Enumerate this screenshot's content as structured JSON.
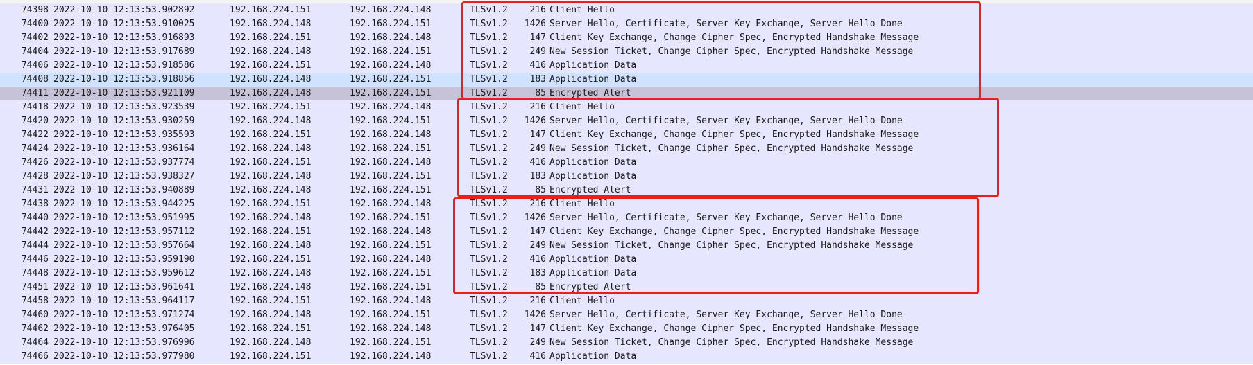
{
  "packets": [
    {
      "no": "74398",
      "time": "2022-10-10 12:13:53.902892",
      "src": "192.168.224.151",
      "dst": "192.168.224.148",
      "proto": "TLSv1.2",
      "len": "216",
      "info": "Client Hello"
    },
    {
      "no": "74400",
      "time": "2022-10-10 12:13:53.910025",
      "src": "192.168.224.148",
      "dst": "192.168.224.151",
      "proto": "TLSv1.2",
      "len": "1426",
      "info": "Server Hello, Certificate, Server Key Exchange, Server Hello Done"
    },
    {
      "no": "74402",
      "time": "2022-10-10 12:13:53.916893",
      "src": "192.168.224.151",
      "dst": "192.168.224.148",
      "proto": "TLSv1.2",
      "len": "147",
      "info": "Client Key Exchange, Change Cipher Spec, Encrypted Handshake Message"
    },
    {
      "no": "74404",
      "time": "2022-10-10 12:13:53.917689",
      "src": "192.168.224.148",
      "dst": "192.168.224.151",
      "proto": "TLSv1.2",
      "len": "249",
      "info": "New Session Ticket, Change Cipher Spec, Encrypted Handshake Message"
    },
    {
      "no": "74406",
      "time": "2022-10-10 12:13:53.918586",
      "src": "192.168.224.151",
      "dst": "192.168.224.148",
      "proto": "TLSv1.2",
      "len": "416",
      "info": "Application Data"
    },
    {
      "no": "74408",
      "time": "2022-10-10 12:13:53.918856",
      "src": "192.168.224.148",
      "dst": "192.168.224.151",
      "proto": "TLSv1.2",
      "len": "183",
      "info": "Application Data",
      "state": "selected"
    },
    {
      "no": "74411",
      "time": "2022-10-10 12:13:53.921109",
      "src": "192.168.224.148",
      "dst": "192.168.224.151",
      "proto": "TLSv1.2",
      "len": "85",
      "info": "Encrypted Alert",
      "state": "related"
    },
    {
      "no": "74418",
      "time": "2022-10-10 12:13:53.923539",
      "src": "192.168.224.151",
      "dst": "192.168.224.148",
      "proto": "TLSv1.2",
      "len": "216",
      "info": "Client Hello"
    },
    {
      "no": "74420",
      "time": "2022-10-10 12:13:53.930259",
      "src": "192.168.224.148",
      "dst": "192.168.224.151",
      "proto": "TLSv1.2",
      "len": "1426",
      "info": "Server Hello, Certificate, Server Key Exchange, Server Hello Done"
    },
    {
      "no": "74422",
      "time": "2022-10-10 12:13:53.935593",
      "src": "192.168.224.151",
      "dst": "192.168.224.148",
      "proto": "TLSv1.2",
      "len": "147",
      "info": "Client Key Exchange, Change Cipher Spec, Encrypted Handshake Message"
    },
    {
      "no": "74424",
      "time": "2022-10-10 12:13:53.936164",
      "src": "192.168.224.148",
      "dst": "192.168.224.151",
      "proto": "TLSv1.2",
      "len": "249",
      "info": "New Session Ticket, Change Cipher Spec, Encrypted Handshake Message"
    },
    {
      "no": "74426",
      "time": "2022-10-10 12:13:53.937774",
      "src": "192.168.224.151",
      "dst": "192.168.224.148",
      "proto": "TLSv1.2",
      "len": "416",
      "info": "Application Data"
    },
    {
      "no": "74428",
      "time": "2022-10-10 12:13:53.938327",
      "src": "192.168.224.148",
      "dst": "192.168.224.151",
      "proto": "TLSv1.2",
      "len": "183",
      "info": "Application Data"
    },
    {
      "no": "74431",
      "time": "2022-10-10 12:13:53.940889",
      "src": "192.168.224.148",
      "dst": "192.168.224.151",
      "proto": "TLSv1.2",
      "len": "85",
      "info": "Encrypted Alert"
    },
    {
      "no": "74438",
      "time": "2022-10-10 12:13:53.944225",
      "src": "192.168.224.151",
      "dst": "192.168.224.148",
      "proto": "TLSv1.2",
      "len": "216",
      "info": "Client Hello"
    },
    {
      "no": "74440",
      "time": "2022-10-10 12:13:53.951995",
      "src": "192.168.224.148",
      "dst": "192.168.224.151",
      "proto": "TLSv1.2",
      "len": "1426",
      "info": "Server Hello, Certificate, Server Key Exchange, Server Hello Done"
    },
    {
      "no": "74442",
      "time": "2022-10-10 12:13:53.957112",
      "src": "192.168.224.151",
      "dst": "192.168.224.148",
      "proto": "TLSv1.2",
      "len": "147",
      "info": "Client Key Exchange, Change Cipher Spec, Encrypted Handshake Message"
    },
    {
      "no": "74444",
      "time": "2022-10-10 12:13:53.957664",
      "src": "192.168.224.148",
      "dst": "192.168.224.151",
      "proto": "TLSv1.2",
      "len": "249",
      "info": "New Session Ticket, Change Cipher Spec, Encrypted Handshake Message"
    },
    {
      "no": "74446",
      "time": "2022-10-10 12:13:53.959190",
      "src": "192.168.224.151",
      "dst": "192.168.224.148",
      "proto": "TLSv1.2",
      "len": "416",
      "info": "Application Data"
    },
    {
      "no": "74448",
      "time": "2022-10-10 12:13:53.959612",
      "src": "192.168.224.148",
      "dst": "192.168.224.151",
      "proto": "TLSv1.2",
      "len": "183",
      "info": "Application Data"
    },
    {
      "no": "74451",
      "time": "2022-10-10 12:13:53.961641",
      "src": "192.168.224.148",
      "dst": "192.168.224.151",
      "proto": "TLSv1.2",
      "len": "85",
      "info": "Encrypted Alert"
    },
    {
      "no": "74458",
      "time": "2022-10-10 12:13:53.964117",
      "src": "192.168.224.151",
      "dst": "192.168.224.148",
      "proto": "TLSv1.2",
      "len": "216",
      "info": "Client Hello"
    },
    {
      "no": "74460",
      "time": "2022-10-10 12:13:53.971274",
      "src": "192.168.224.148",
      "dst": "192.168.224.151",
      "proto": "TLSv1.2",
      "len": "1426",
      "info": "Server Hello, Certificate, Server Key Exchange, Server Hello Done"
    },
    {
      "no": "74462",
      "time": "2022-10-10 12:13:53.976405",
      "src": "192.168.224.151",
      "dst": "192.168.224.148",
      "proto": "TLSv1.2",
      "len": "147",
      "info": "Client Key Exchange, Change Cipher Spec, Encrypted Handshake Message"
    },
    {
      "no": "74464",
      "time": "2022-10-10 12:13:53.976996",
      "src": "192.168.224.148",
      "dst": "192.168.224.151",
      "proto": "TLSv1.2",
      "len": "249",
      "info": "New Session Ticket, Change Cipher Spec, Encrypted Handshake Message"
    },
    {
      "no": "74466",
      "time": "2022-10-10 12:13:53.977980",
      "src": "192.168.224.151",
      "dst": "192.168.224.148",
      "proto": "TLSv1.2",
      "len": "416",
      "info": "Application Data"
    }
  ],
  "colors": {
    "row_tls": "#e7e6ff",
    "row_selected": "#cfe2ff",
    "row_related": "#c6c3d9",
    "annotation_box": "#e8201c"
  },
  "annotation_boxes": [
    {
      "id": "handshake-group-1",
      "first_no": "74398",
      "last_no": "74411"
    },
    {
      "id": "handshake-group-2",
      "first_no": "74418",
      "last_no": "74431"
    },
    {
      "id": "handshake-group-3",
      "first_no": "74438",
      "last_no": "74451"
    }
  ]
}
